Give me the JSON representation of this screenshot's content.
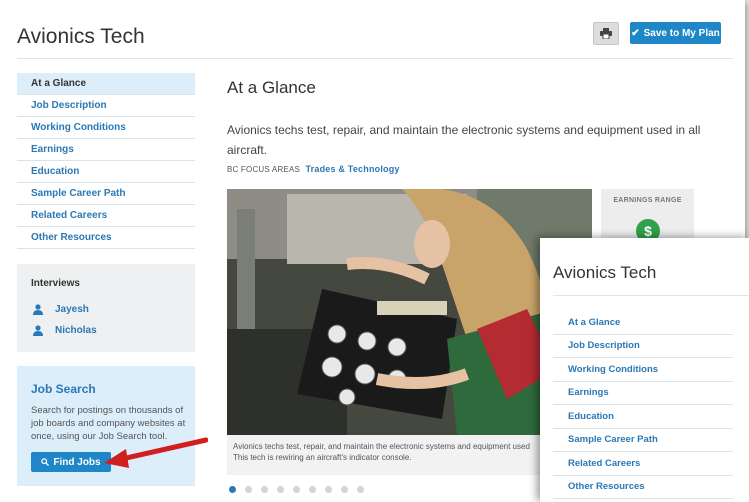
{
  "header": {
    "title": "Avionics Tech",
    "save_label": "Save to My Plan"
  },
  "nav": {
    "items": [
      {
        "label": "At a Glance"
      },
      {
        "label": "Job Description"
      },
      {
        "label": "Working Conditions"
      },
      {
        "label": "Earnings"
      },
      {
        "label": "Education"
      },
      {
        "label": "Sample Career Path"
      },
      {
        "label": "Related Careers"
      },
      {
        "label": "Other Resources"
      }
    ]
  },
  "interviews": {
    "heading": "Interviews",
    "people": [
      "Jayesh",
      "Nicholas"
    ]
  },
  "job_search": {
    "heading": "Job Search",
    "description": "Search for postings on thousands of job boards and company websites at once, using our Job Search tool.",
    "button_label": "Find Jobs"
  },
  "main": {
    "heading": "At a Glance",
    "intro": "Avionics techs test, repair, and maintain the electronic systems and equipment used in all aircraft.",
    "focus_label": "BC FOCUS AREAS",
    "focus_value": "Trades & Technology",
    "caption_line1": "Avionics techs test, repair, and maintain the electronic systems and equipment used",
    "caption_line2": "This tech is rewiring an aircraft's indicator console."
  },
  "earnings": {
    "heading": "EARNINGS RANGE",
    "icon": "$"
  },
  "zoom": {
    "title": "Avionics Tech"
  },
  "icons": {
    "print": "printer-icon",
    "save": "check-icon",
    "person": "person-icon",
    "search": "search-icon"
  },
  "colors": {
    "accent": "#1f86c7",
    "link": "#2a78b6",
    "active_bg": "#dbeef9",
    "arrow": "#d11f1f"
  }
}
